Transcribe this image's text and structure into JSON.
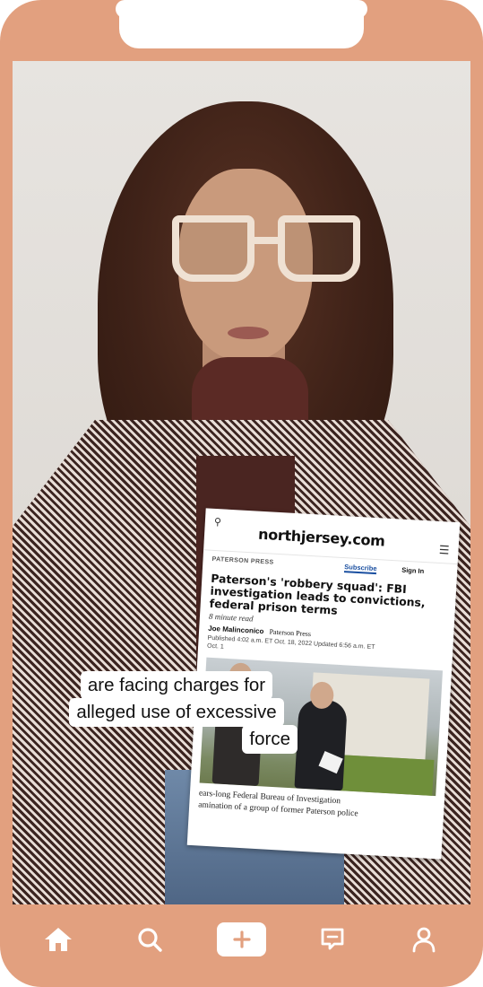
{
  "article": {
    "site_logo": "northjersey.com",
    "section": "PATERSON PRESS",
    "subscribe_label": "Subscribe",
    "signin_label": "Sign In",
    "headline": "Paterson's 'robbery squad': FBI investigation leads to convictions, federal prison terms",
    "read_time": "8 minute read",
    "author": "Joe Malinconico",
    "publication": "Paterson Press",
    "published_line": "Published 4:02 a.m. ET Oct. 18, 2022",
    "updated_line": "Updated 6:56 a.m. ET",
    "date_prefix": "Oct. 1",
    "body_line1": "ears-long Federal Bureau of Investigation",
    "body_line2": "amination of a group of former Paterson police"
  },
  "caption": {
    "line1": "are facing charges for",
    "line2": "alleged use of excessive",
    "line3": "force"
  },
  "nav": {
    "home_icon": "home-icon",
    "search_icon": "search-icon",
    "create_icon": "plus-icon",
    "inbox_icon": "message-icon",
    "profile_icon": "profile-icon"
  },
  "colors": {
    "frame": "#e2a07f",
    "accent_link": "#1a4fa0"
  }
}
